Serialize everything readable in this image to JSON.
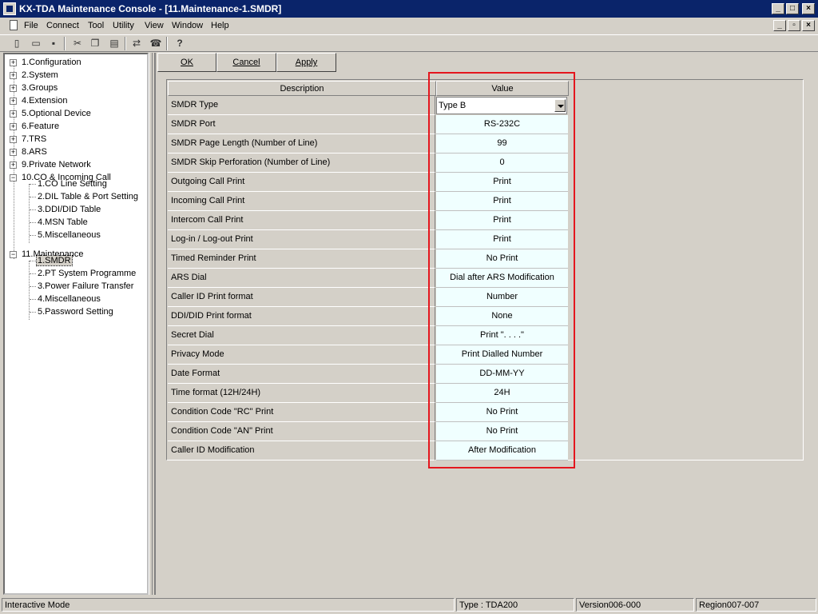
{
  "window": {
    "title": "KX-TDA Maintenance Console - [11.Maintenance-1.SMDR]"
  },
  "menu": [
    "File",
    "Connect",
    "Tool",
    "Utility",
    "View",
    "Window",
    "Help"
  ],
  "toolbar_icons": [
    "new-icon",
    "open-icon",
    "save-icon",
    "cut-icon",
    "copy-icon",
    "paste-icon",
    "connect-icon",
    "disconnect-icon",
    "help-icon"
  ],
  "tree": {
    "items": [
      {
        "label": "1.Configuration",
        "level": 0,
        "expander": "+"
      },
      {
        "label": "2.System",
        "level": 0,
        "expander": "+"
      },
      {
        "label": "3.Groups",
        "level": 0,
        "expander": "+"
      },
      {
        "label": "4.Extension",
        "level": 0,
        "expander": "+"
      },
      {
        "label": "5.Optional Device",
        "level": 0,
        "expander": "+"
      },
      {
        "label": "6.Feature",
        "level": 0,
        "expander": "+"
      },
      {
        "label": "7.TRS",
        "level": 0,
        "expander": "+"
      },
      {
        "label": "8.ARS",
        "level": 0,
        "expander": "+"
      },
      {
        "label": "9.Private Network",
        "level": 0,
        "expander": "+"
      },
      {
        "label": "10.CO & Incoming Call",
        "level": 0,
        "expander": "-"
      },
      {
        "label": "1.CO Line Setting",
        "level": 1
      },
      {
        "label": "2.DIL Table & Port Setting",
        "level": 1
      },
      {
        "label": "3.DDI/DID Table",
        "level": 1
      },
      {
        "label": "4.MSN Table",
        "level": 1
      },
      {
        "label": "5.Miscellaneous",
        "level": 1
      },
      {
        "label": "11.Maintenance",
        "level": 0,
        "expander": "-"
      },
      {
        "label": "1.SMDR",
        "level": 1,
        "selected": true
      },
      {
        "label": "2.PT System Programme",
        "level": 1
      },
      {
        "label": "3.Power Failure Transfer",
        "level": 1
      },
      {
        "label": "4.Miscellaneous",
        "level": 1
      },
      {
        "label": "5.Password Setting",
        "level": 1
      }
    ]
  },
  "buttons": {
    "ok": "OK",
    "cancel": "Cancel",
    "apply": "Apply"
  },
  "table": {
    "headers": {
      "description": "Description",
      "value": "Value"
    },
    "rows": [
      {
        "desc": "SMDR Type",
        "value": "Type B",
        "type": "select"
      },
      {
        "desc": "SMDR Port",
        "value": "RS-232C"
      },
      {
        "desc": "SMDR Page Length (Number of Line)",
        "value": "99"
      },
      {
        "desc": "SMDR Skip Perforation (Number of Line)",
        "value": "0"
      },
      {
        "desc": "Outgoing Call Print",
        "value": "Print"
      },
      {
        "desc": "Incoming Call Print",
        "value": "Print"
      },
      {
        "desc": "Intercom Call Print",
        "value": "Print"
      },
      {
        "desc": "Log-in / Log-out Print",
        "value": "Print"
      },
      {
        "desc": "Timed Reminder Print",
        "value": "No Print"
      },
      {
        "desc": "ARS Dial",
        "value": "Dial after ARS Modification"
      },
      {
        "desc": "Caller ID Print format",
        "value": "Number"
      },
      {
        "desc": "DDI/DID Print format",
        "value": "None"
      },
      {
        "desc": "Secret Dial",
        "value": "Print \". . . .\""
      },
      {
        "desc": "Privacy Mode",
        "value": "Print Dialled Number"
      },
      {
        "desc": "Date Format",
        "value": "DD-MM-YY"
      },
      {
        "desc": "Time format (12H/24H)",
        "value": "24H"
      },
      {
        "desc": "Condition Code \"RC\" Print",
        "value": "No Print"
      },
      {
        "desc": "Condition Code \"AN\" Print",
        "value": "No Print"
      },
      {
        "desc": "Caller ID Modification",
        "value": "After Modification"
      }
    ]
  },
  "highlight": {
    "color": "#e4161e"
  },
  "status": {
    "mode": "Interactive Mode",
    "type": "Type : TDA200",
    "version": "Version006-000",
    "region": "Region007-007"
  }
}
